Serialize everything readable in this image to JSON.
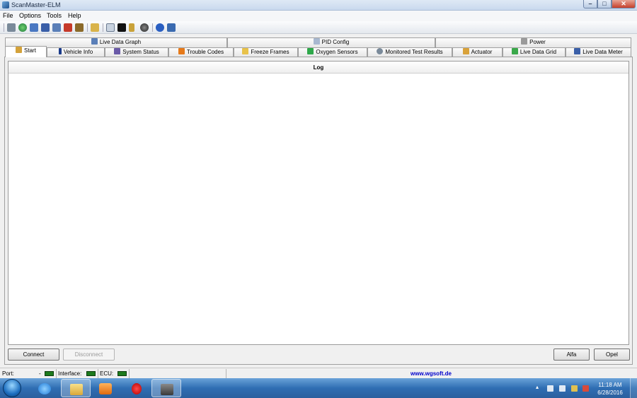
{
  "window": {
    "title": "ScanMaster-ELM",
    "controls": {
      "minimize": "–",
      "maximize": "□",
      "close": "✕"
    }
  },
  "menu": [
    "File",
    "Options",
    "Tools",
    "Help"
  ],
  "toolbar": {
    "icons": [
      "wrench-icon",
      "globe-icon",
      "document-icon",
      "grid-icon",
      "chart-icon",
      "battery-icon",
      "gear-icon",
      "clipboard-icon",
      "chat-icon",
      "terminal-icon",
      "fuel-icon",
      "disc-icon",
      "info-icon",
      "book-icon"
    ]
  },
  "tabs": {
    "row1": [
      {
        "label": "Live Data Graph",
        "icon": "chart-icon"
      },
      {
        "label": "PID Config",
        "icon": "document-icon"
      },
      {
        "label": "Power",
        "icon": "pencil-icon"
      }
    ],
    "row2": [
      {
        "label": "Start",
        "icon": "box-icon",
        "active": true
      },
      {
        "label": "Vehicle Info",
        "icon": "info-icon"
      },
      {
        "label": "System Status",
        "icon": "monitor-icon"
      },
      {
        "label": "Trouble Codes",
        "icon": "warning-icon"
      },
      {
        "label": "Freeze Frames",
        "icon": "snowflake-icon"
      },
      {
        "label": "Oxygen Sensors",
        "icon": "sensor-icon"
      },
      {
        "label": "Monitored Test Results",
        "icon": "gear-icon"
      },
      {
        "label": "Actuator",
        "icon": "actuator-icon"
      },
      {
        "label": "Live Data Grid",
        "icon": "grid-icon"
      },
      {
        "label": "Live Data Meter",
        "icon": "meter-icon"
      }
    ]
  },
  "log": {
    "header": "Log"
  },
  "buttons": {
    "connect": "Connect",
    "disconnect": "Disconnect",
    "alfa": "Alfa",
    "opel": "Opel"
  },
  "status": {
    "port_label": "Port:",
    "port_value": "-",
    "interface_label": "Interface:",
    "ecu_label": "ECU:",
    "link": "www.wgsoft.de"
  },
  "taskbar": {
    "items": [
      "internet-explorer-icon",
      "file-explorer-icon",
      "media-player-icon",
      "opera-icon",
      "scanmaster-icon"
    ],
    "time": "11:18 AM",
    "date": "6/28/2016"
  },
  "colors": {
    "led_on": "#1d7a1d",
    "link": "#0000cc",
    "taskbar": "#2f6eb3"
  }
}
